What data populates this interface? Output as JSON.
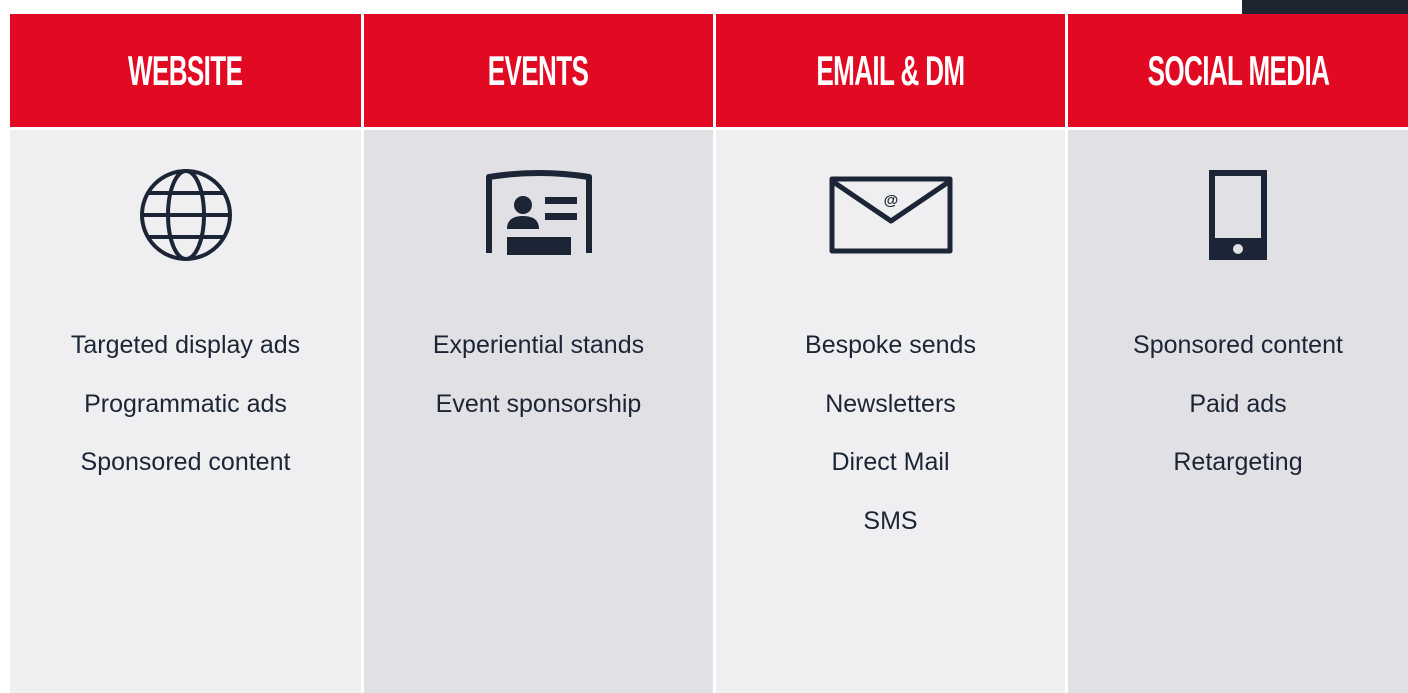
{
  "colors": {
    "header_red": "#e20a23",
    "icon_dark": "#1c2535",
    "body_light": "#efeff1",
    "body_dark": "#e1e0e5"
  },
  "columns": [
    {
      "title": "WEBSITE",
      "icon": "globe-icon",
      "items": [
        "Targeted display ads",
        "Programmatic ads",
        "Sponsored content"
      ]
    },
    {
      "title": "EVENTS",
      "icon": "event-badge-icon",
      "items": [
        "Experiential stands",
        "Event sponsorship"
      ]
    },
    {
      "title": "EMAIL & DM",
      "icon": "email-envelope-icon",
      "items": [
        "Bespoke sends",
        "Newsletters",
        "Direct Mail",
        "SMS"
      ]
    },
    {
      "title": "SOCIAL MEDIA",
      "icon": "mobile-phone-icon",
      "items": [
        "Sponsored content",
        "Paid ads",
        "Retargeting"
      ]
    }
  ]
}
